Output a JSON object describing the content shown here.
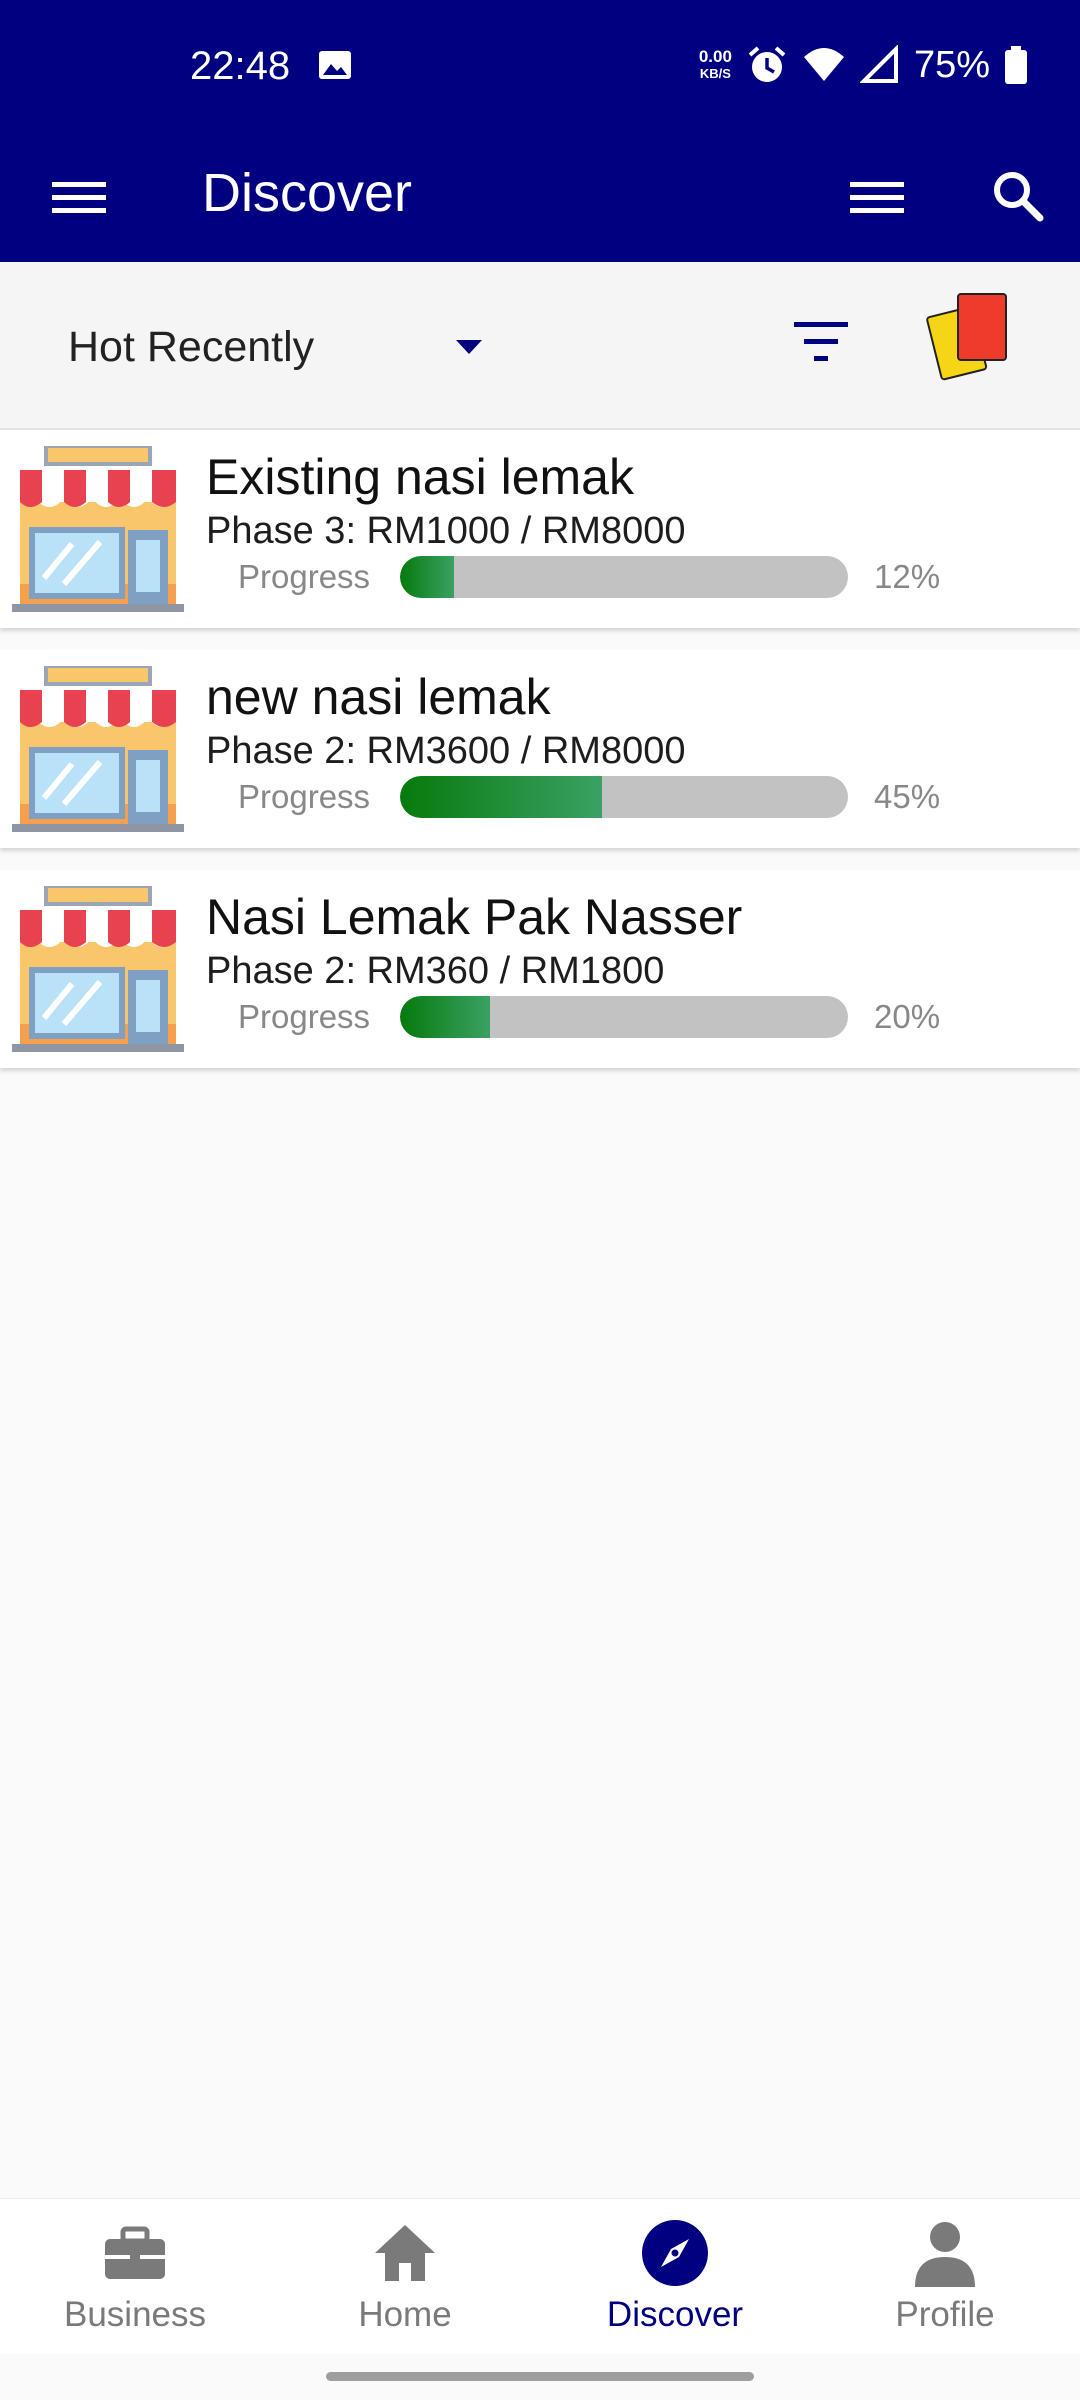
{
  "status_bar": {
    "time": "22:48",
    "net_speed_value": "0.00",
    "net_speed_unit": "KB/S",
    "battery": "75%",
    "icons": [
      "image-icon",
      "alarm-icon",
      "wifi-icon",
      "signal-icon",
      "battery-icon"
    ]
  },
  "app_bar": {
    "title": "Discover"
  },
  "filter_bar": {
    "sort_value": "Hot Recently"
  },
  "projects": [
    {
      "title": "Existing nasi lemak",
      "phase": "Phase 3: RM1000 / RM8000",
      "progress_label": "Progress",
      "progress": 12,
      "progress_text": "12%"
    },
    {
      "title": "new nasi lemak",
      "phase": "Phase 2: RM3600 / RM8000",
      "progress_label": "Progress",
      "progress": 45,
      "progress_text": "45%"
    },
    {
      "title": "Nasi Lemak Pak Nasser",
      "phase": "Phase 2: RM360 / RM1800",
      "progress_label": "Progress",
      "progress": 20,
      "progress_text": "20%"
    }
  ],
  "bottom_nav": {
    "items": [
      {
        "label": "Business",
        "icon": "briefcase-icon"
      },
      {
        "label": "Home",
        "icon": "home-icon"
      },
      {
        "label": "Discover",
        "icon": "compass-icon",
        "active": true
      },
      {
        "label": "Profile",
        "icon": "person-icon"
      }
    ]
  },
  "colors": {
    "primary": "#000080",
    "progress_fill": "#067a0c",
    "progress_track": "#c2c2c2",
    "inactive_nav": "#7a7a7a"
  }
}
